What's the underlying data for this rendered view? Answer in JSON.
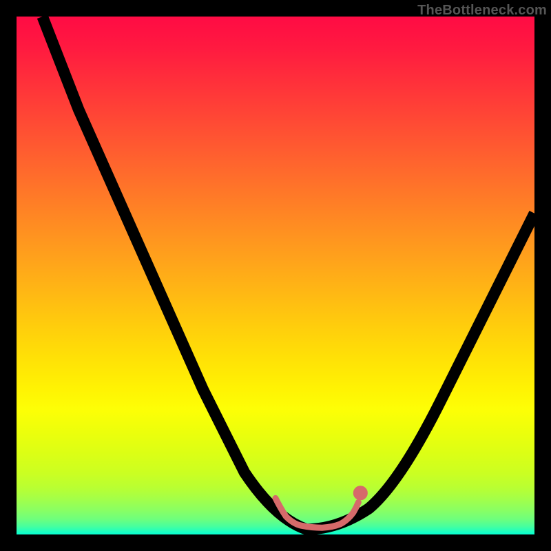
{
  "watermark": "TheBottleneck.com",
  "colors": {
    "frame_bg": "#000000",
    "curve": "#000000",
    "squiggle": "#d66a6a",
    "gradient_top": "#ff0b44",
    "gradient_mid": "#ffe106",
    "gradient_bottom": "#05ffd3"
  },
  "chart_data": {
    "type": "line",
    "title": "",
    "xlabel": "",
    "ylabel": "",
    "xlim": [
      0,
      100
    ],
    "ylim": [
      0,
      100
    ],
    "note": "No axis ticks or labels visible; values estimated from pixel position mapped to 0-100.",
    "series": [
      {
        "name": "main-v-curve",
        "color": "#000000",
        "points": [
          {
            "x": 5,
            "y": 100
          },
          {
            "x": 12,
            "y": 82
          },
          {
            "x": 20,
            "y": 64
          },
          {
            "x": 28,
            "y": 46
          },
          {
            "x": 36,
            "y": 28
          },
          {
            "x": 44,
            "y": 12
          },
          {
            "x": 50,
            "y": 3
          },
          {
            "x": 56,
            "y": 1
          },
          {
            "x": 62,
            "y": 2
          },
          {
            "x": 68,
            "y": 5
          },
          {
            "x": 74,
            "y": 12
          },
          {
            "x": 82,
            "y": 26
          },
          {
            "x": 90,
            "y": 42
          },
          {
            "x": 100,
            "y": 62
          }
        ]
      },
      {
        "name": "bottom-squiggle",
        "color": "#d66a6a",
        "points": [
          {
            "x": 50,
            "y": 6
          },
          {
            "x": 52,
            "y": 3
          },
          {
            "x": 54,
            "y": 2
          },
          {
            "x": 56,
            "y": 1.5
          },
          {
            "x": 58,
            "y": 1.3
          },
          {
            "x": 60,
            "y": 1.5
          },
          {
            "x": 62,
            "y": 2
          },
          {
            "x": 64,
            "y": 3
          },
          {
            "x": 66,
            "y": 5
          }
        ],
        "end_marker": {
          "x": 66,
          "y": 6.5
        }
      }
    ]
  }
}
